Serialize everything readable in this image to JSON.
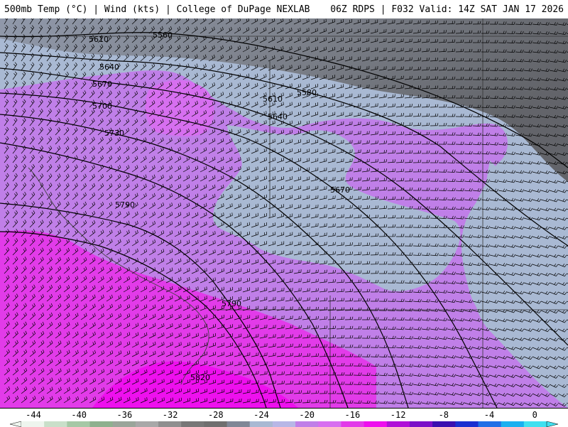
{
  "header": {
    "left": "500mb Temp (°C) | Wind (kts) | College of DuPage NEXLAB",
    "right": "06Z RDPS | F032 Valid: 14Z SAT JAN 17 2026"
  },
  "map": {
    "contour_labels": [
      "5610",
      "5560",
      "5640",
      "5670",
      "5700",
      "5730",
      "5610",
      "5580",
      "5640",
      "5670",
      "5790",
      "5790",
      "5820"
    ],
    "colors": {
      "coldest": "#6f6f6f",
      "gray_blue": "#a9b9d3",
      "lavender": "#c07fe8",
      "violet": "#d76ff0",
      "magenta": "#e23be9",
      "bright_magenta": "#ee10ee",
      "contour": "#000000",
      "barb": "#000000"
    }
  },
  "colorbar": {
    "ticks": [
      "-44",
      "-40",
      "-36",
      "-32",
      "-28",
      "-24",
      "-20",
      "-16",
      "-12",
      "-8",
      "-4",
      "0"
    ],
    "colors": [
      "#eef5ee",
      "#c9dfc9",
      "#a6c8a6",
      "#8eb08e",
      "#9aa59a",
      "#a8a8a8",
      "#8f8f8f",
      "#777777",
      "#6f6f6f",
      "#7f8796",
      "#a9b9d3",
      "#b7b7e6",
      "#c07fe8",
      "#d76ff0",
      "#e23be9",
      "#ee10ee",
      "#b010d8",
      "#7a10c8",
      "#3a10b0",
      "#1a2fd0",
      "#1f6fe6",
      "#1ab0f0",
      "#40e0f0"
    ]
  }
}
